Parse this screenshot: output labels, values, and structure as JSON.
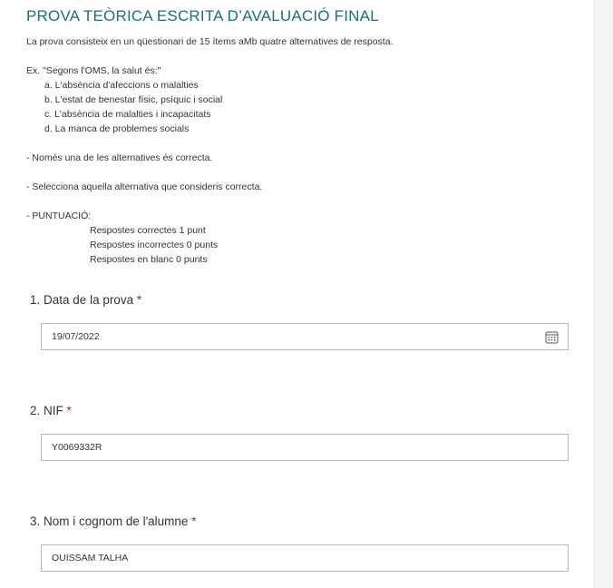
{
  "form": {
    "title": "PROVA TEÒRICA ESCRITA D’AVALUACIÓ FINAL",
    "description": {
      "intro": "La prova consisteix en un qüestionari de 15 ítems aMb quatre alternatives de resposta.",
      "example_question": "Ex. \"Segons l'OMS, la salut és:\"",
      "example_options": [
        "a. L'absència d'afeccions o malalties",
        "b. L'estat de benestar físic, psíquic i social",
        "c. L'absència de malalties i incapacitats",
        "d. La manca de problemes socials"
      ],
      "rule_1": "- Només una de les alternatives és correcta.",
      "rule_2": "- Selecciona aquella alternativa que consideris correcta.",
      "scoring_heading": "- PUNTUACIÓ:",
      "scoring": [
        "Respostes correctes 1 punt",
        "Respostes incorrectes 0 punts",
        "Respostes en blanc 0 punts"
      ]
    }
  },
  "questions": [
    {
      "number": "1.",
      "label": "Data de la prova",
      "required_mark": "*",
      "value": "19/07/2022",
      "icon": "calendar-icon"
    },
    {
      "number": "2.",
      "label": "NIF",
      "required_mark": "*",
      "value": "Y0069332R"
    },
    {
      "number": "3.",
      "label": "Nom i cognom de l'alumne",
      "required_mark": "*",
      "value": "OUISSAM TALHA"
    }
  ],
  "colors": {
    "title": "#1f6f77",
    "required": "#a4262c",
    "border": "#b8b8b8"
  }
}
